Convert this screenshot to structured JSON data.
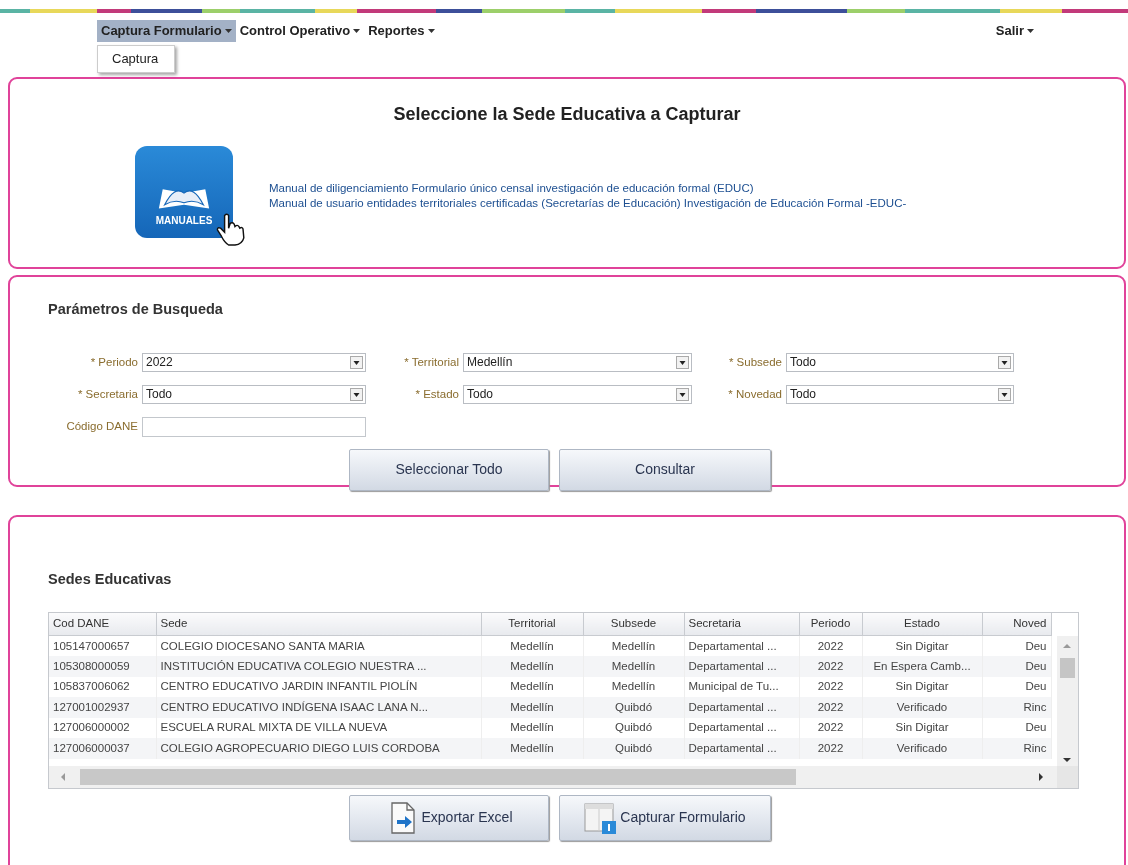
{
  "menu": [
    {
      "label": "Captura Formulario",
      "selected": true,
      "submenu": [
        "Captura"
      ]
    },
    {
      "label": "Control Operativo",
      "selected": false
    },
    {
      "label": "Reportes",
      "selected": false
    }
  ],
  "user_menu": {
    "label": "Salir"
  },
  "header_panel": {
    "title": "Seleccione la Sede Educativa a Capturar",
    "manuals_label": "MANUALES",
    "links": [
      "Manual de diligenciamiento Formulario único censal investigación de educación formal (EDUC)",
      "Manual de usuario entidades territoriales certificadas (Secretarías de Educación) Investigación de Educación Formal -EDUC-"
    ]
  },
  "search_panel": {
    "title": "Parámetros de Busqueda",
    "fields": [
      {
        "label": "* Periodo",
        "kind": "select",
        "value": "2022"
      },
      {
        "label": "* Territorial",
        "kind": "select",
        "value": "Medellín"
      },
      {
        "label": "* Subsede",
        "kind": "select",
        "value": "Todo"
      },
      {
        "label": "* Secretaria",
        "kind": "select",
        "value": "Todo"
      },
      {
        "label": "* Estado",
        "kind": "select",
        "value": "Todo"
      },
      {
        "label": "* Novedad",
        "kind": "select",
        "value": "Todo"
      },
      {
        "label": "Código DANE",
        "kind": "text"
      }
    ],
    "buttons": [
      "Seleccionar Todo",
      "Consultar"
    ]
  },
  "results_panel": {
    "title": "Sedes Educativas",
    "table": {
      "columns": [
        "Cod DANE",
        "Sede",
        "Territorial",
        "Subsede",
        "Secretaria",
        "Periodo",
        "Estado",
        "Noved"
      ],
      "rows": [
        [
          "105147000657",
          "COLEGIO DIOCESANO SANTA MARIA",
          "Medellín",
          "Medellín",
          "Departamental ...",
          "2022",
          "Sin Digitar",
          "Deu"
        ],
        [
          "105308000059",
          "INSTITUCIÓN EDUCATIVA COLEGIO NUESTRA ...",
          "Medellín",
          "Medellín",
          "Departamental ...",
          "2022",
          "En Espera Camb...",
          "Deu"
        ],
        [
          "105837006062",
          "CENTRO EDUCATIVO JARDIN INFANTIL PIOLÍN",
          "Medellín",
          "Medellín",
          "Municipal de Tu...",
          "2022",
          "Sin Digitar",
          "Deu"
        ],
        [
          "127001002937",
          "CENTRO EDUCATIVO INDÍGENA ISAAC LANA N...",
          "Medellín",
          "Quibdó",
          "Departamental ...",
          "2022",
          "Verificado",
          "Rinc"
        ],
        [
          "127006000002",
          "ESCUELA RURAL MIXTA DE VILLA NUEVA",
          "Medellín",
          "Quibdó",
          "Departamental ...",
          "2022",
          "Sin Digitar",
          "Deu"
        ],
        [
          "127006000037",
          "COLEGIO AGROPECUARIO DIEGO LUIS CORDOBA",
          "Medellín",
          "Quibdó",
          "Departamental ...",
          "2022",
          "Verificado",
          "Rinc"
        ]
      ]
    },
    "buttons": [
      {
        "label": "Exportar Excel",
        "kind": "export"
      },
      {
        "label": "Capturar Formulario",
        "kind": "form"
      }
    ]
  }
}
